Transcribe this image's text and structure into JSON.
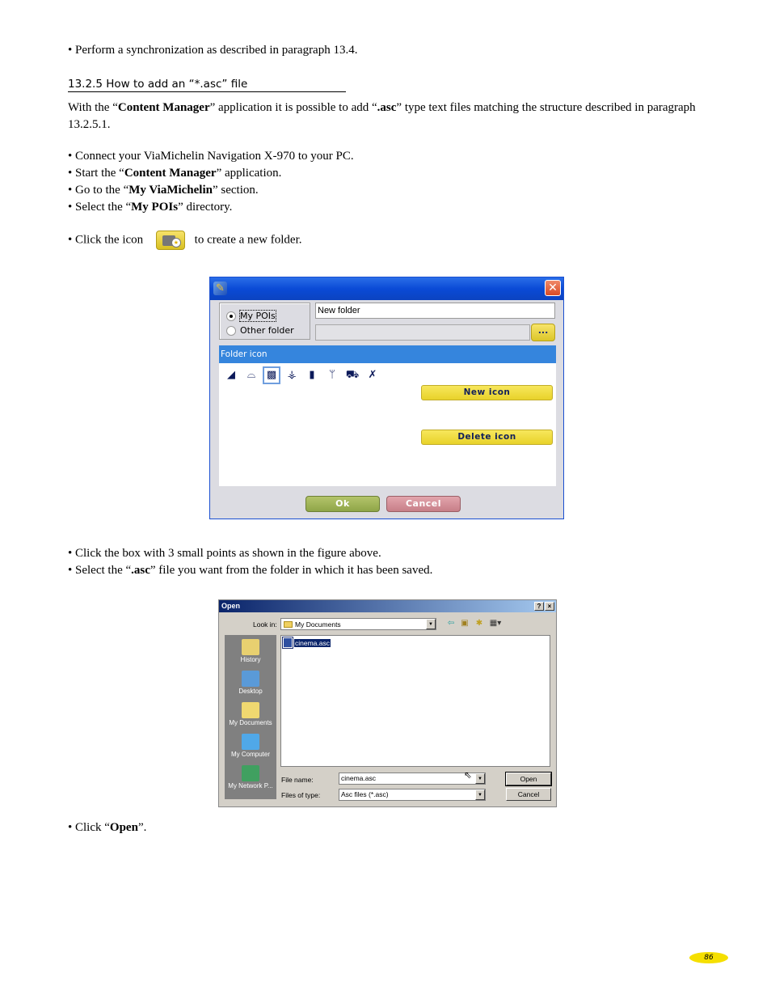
{
  "doc": {
    "line_sync": "• Perform a synchronization as described in paragraph 13.4.",
    "heading": "13.2.5 How to add an “*.asc” file",
    "intro": {
      "p1": "With the “",
      "b1": "Content Manager",
      "p2": "” application it is possible to add “",
      "b2": ".asc",
      "p3": "” type text files matching the structure described in paragraph 13.2.5.1."
    },
    "steps": [
      {
        "pre": "• Connect your ViaMichelin Navigation X-970 to your PC.",
        "bold": "",
        "post": ""
      },
      {
        "pre": "• Start the “",
        "bold": "Content Manager",
        "post": "” application."
      },
      {
        "pre": "• Go to the “",
        "bold": "My ViaMichelin",
        "post": "” section."
      },
      {
        "pre": "• Select the “",
        "bold": "My POIs",
        "post": "” directory."
      }
    ],
    "click_icon": {
      "pre": "• Click the icon",
      "post": "to create a new folder.",
      "icon": "new-folder-icon"
    },
    "steps2": [
      {
        "pre": "• Click the box with 3 small points as shown in the figure above.",
        "bold": "",
        "post": ""
      },
      {
        "pre": "• Select the “",
        "bold": ".asc",
        "post": "” file you want from the folder in which it has been saved."
      }
    ],
    "final": {
      "pre": "• Click “",
      "bold": "Open",
      "post": "”."
    },
    "page_number": "86"
  },
  "new_folder_dialog": {
    "app_icon": "pen-icon",
    "close_icon": "✕",
    "radio_options": [
      {
        "label": "My POIs",
        "selected": true
      },
      {
        "label": "Other folder",
        "selected": false
      }
    ],
    "name_value": "New folder",
    "path_value": "",
    "browse_label": "...",
    "panel_title": "Folder icon",
    "icons": [
      {
        "name": "cinema-icon",
        "glyph": "◢"
      },
      {
        "name": "shopping-basket-icon",
        "glyph": "⚲"
      },
      {
        "name": "checkered-icon",
        "glyph": "▩"
      },
      {
        "name": "satellite-dish-icon",
        "glyph": "📡"
      },
      {
        "name": "fuel-pump-icon",
        "glyph": "⛽"
      },
      {
        "name": "restaurant-icon",
        "glyph": "🍴"
      },
      {
        "name": "car-icon",
        "glyph": "🚗"
      },
      {
        "name": "sport-icon",
        "glyph": "⚽"
      }
    ],
    "selected_icon_index": 2,
    "new_icon_label": "New icon",
    "delete_icon_label": "Delete icon",
    "ok_label": "Ok",
    "cancel_label": "Cancel"
  },
  "open_dialog": {
    "title": "Open",
    "help_btn": "?",
    "close_btn": "×",
    "look_in_label": "Look in:",
    "look_in_value": "My Documents",
    "places": [
      "History",
      "Desktop",
      "My Documents",
      "My Computer",
      "My Network P..."
    ],
    "files": [
      "cinema.asc"
    ],
    "file_name_label": "File name:",
    "file_name_value": "cinema.asc",
    "file_type_label": "Files of type:",
    "file_type_value": "Asc files (*.asc)",
    "open_label": "Open",
    "cancel_label": "Cancel"
  }
}
